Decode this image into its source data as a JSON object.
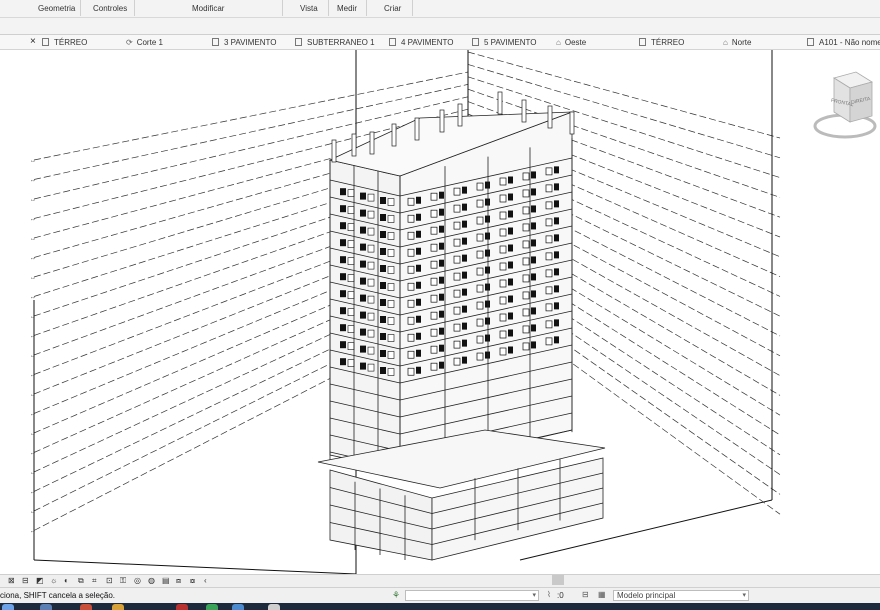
{
  "ribbon": {
    "panels": [
      "Geometria",
      "Controles",
      "Modificar",
      "Vista",
      "Medir",
      "Criar"
    ]
  },
  "tabs": [
    {
      "label": "TÉRREO",
      "icon": "floor-plan-icon"
    },
    {
      "label": "Corte 1",
      "icon": "section-icon"
    },
    {
      "label": "3 PAVIMENTO",
      "icon": "floor-plan-icon"
    },
    {
      "label": "SUBTERRANEO 1",
      "icon": "floor-plan-icon"
    },
    {
      "label": "4 PAVIMENTO",
      "icon": "floor-plan-icon"
    },
    {
      "label": "5 PAVIMENTO",
      "icon": "floor-plan-icon"
    },
    {
      "label": "Oeste",
      "icon": "elevation-icon"
    },
    {
      "label": "TÉRREO",
      "icon": "floor-plan-icon"
    },
    {
      "label": "Norte",
      "icon": "elevation-icon"
    },
    {
      "label": "A101 - Não nome",
      "icon": "sheet-icon"
    }
  ],
  "close_glyph": "×",
  "viewcube": {
    "front_label": "FRONTAL",
    "right_label": "DIREITA"
  },
  "status": {
    "hint": "ciona, SHIFT cancela a seleção.",
    "coord": ":0",
    "model": "Modelo principal"
  },
  "colors": {
    "model_line": "#222222",
    "background": "#ffffff",
    "taskbar": "#1d2a3d"
  }
}
